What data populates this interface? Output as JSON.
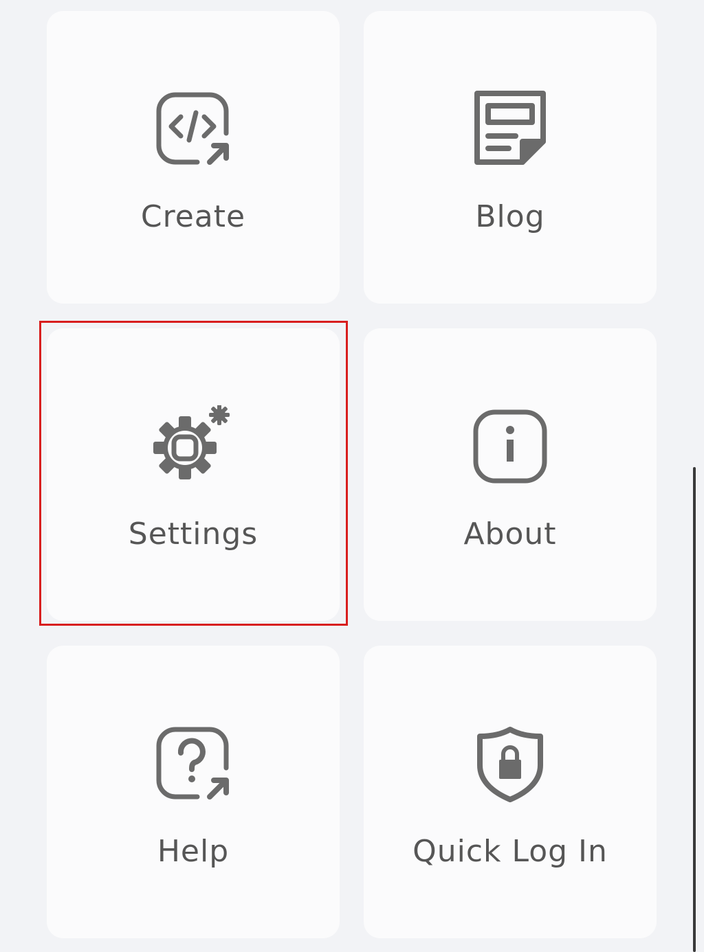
{
  "menu": {
    "items": [
      {
        "label": "Create",
        "icon": "code-external-link-icon"
      },
      {
        "label": "Blog",
        "icon": "blog-document-icon"
      },
      {
        "label": "Settings",
        "icon": "gear-icon",
        "highlighted": true
      },
      {
        "label": "About",
        "icon": "info-icon"
      },
      {
        "label": "Help",
        "icon": "help-external-link-icon"
      },
      {
        "label": "Quick Log In",
        "icon": "shield-lock-icon"
      }
    ]
  },
  "colors": {
    "page_background": "#f2f3f6",
    "tile_background": "#fbfbfc",
    "icon_color": "#6b6b6b",
    "label_color": "#565656",
    "highlight_border": "#d81e1e"
  }
}
